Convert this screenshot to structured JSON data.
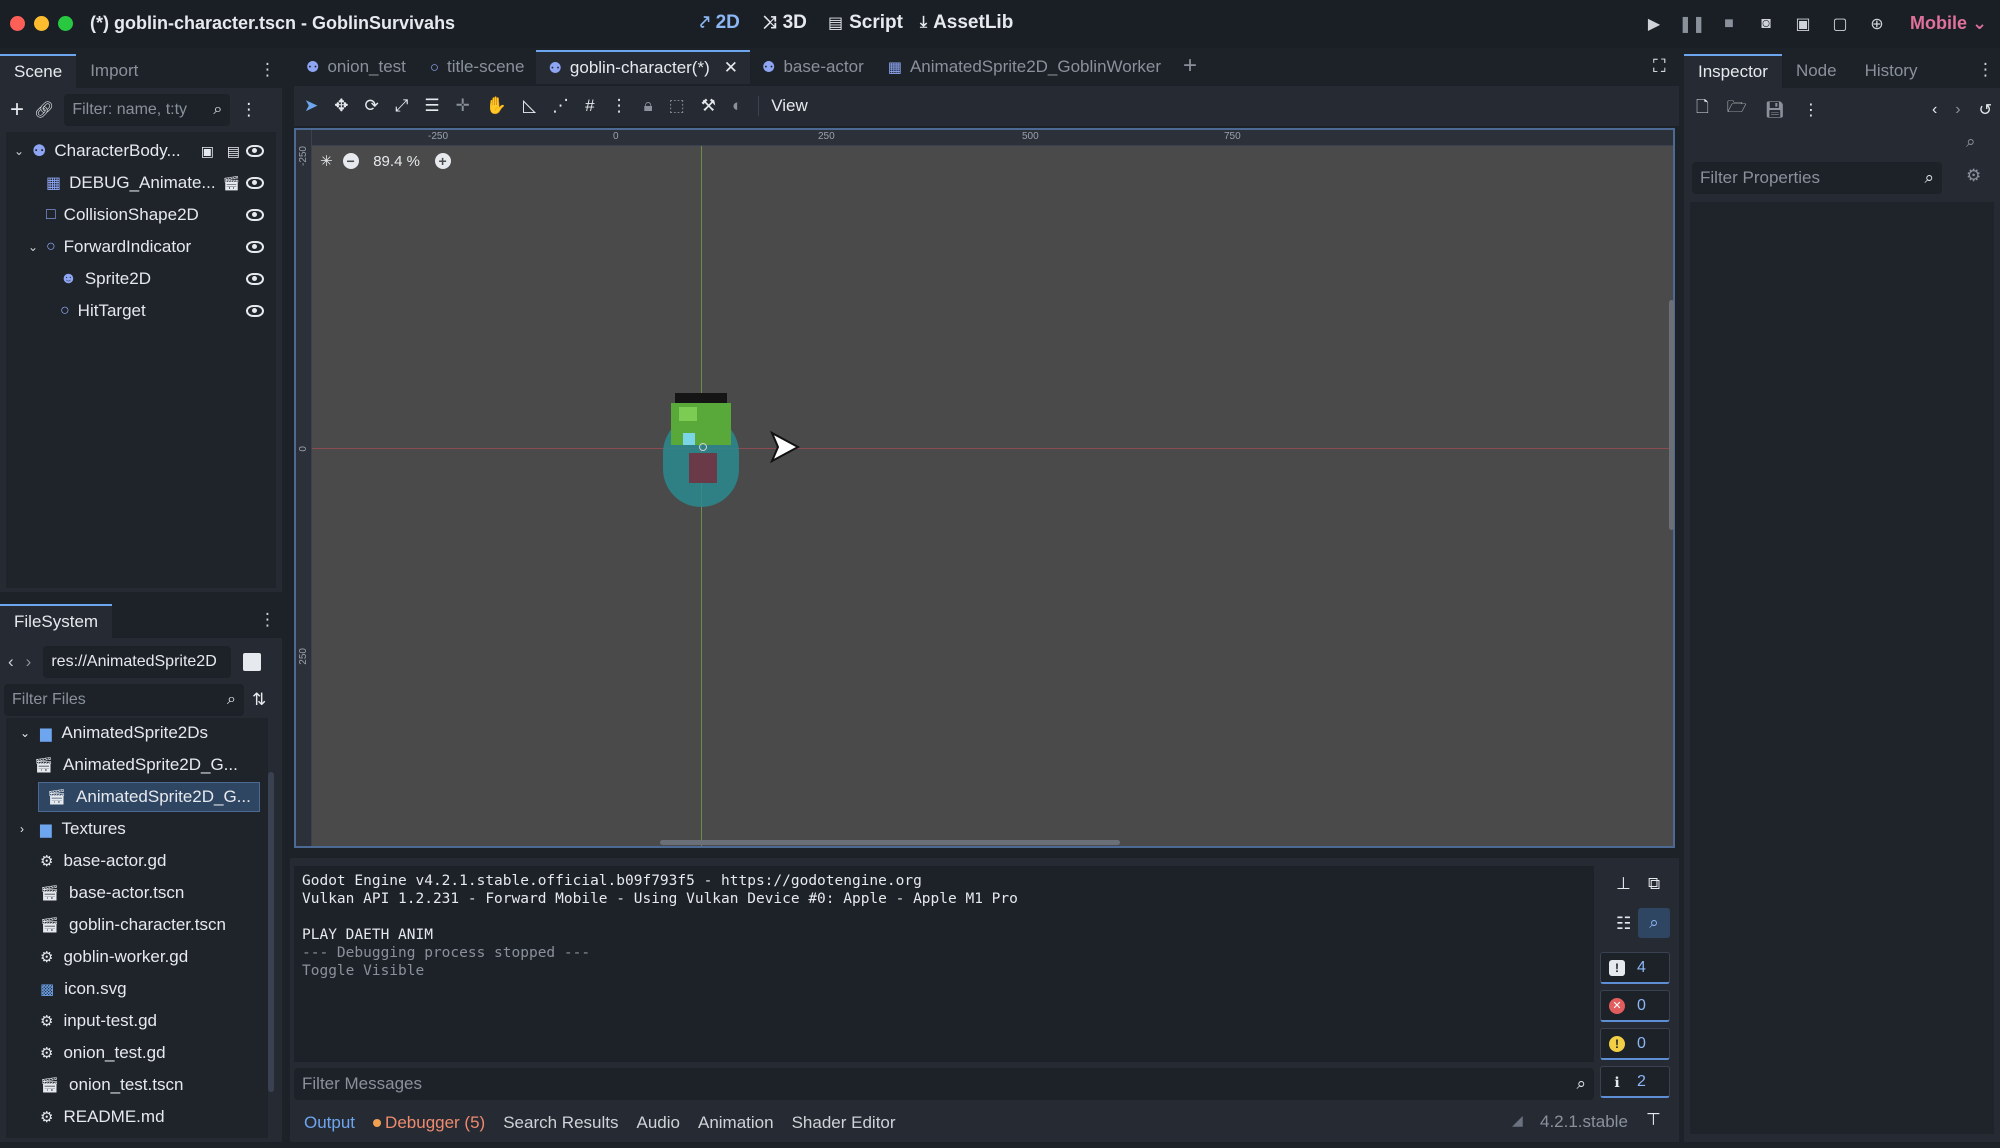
{
  "window": {
    "title": "(*) goblin-character.tscn - GoblinSurvivahs"
  },
  "modes": [
    {
      "label": "2D",
      "icon": "2d-icon",
      "active": true
    },
    {
      "label": "3D",
      "icon": "3d-icon"
    },
    {
      "label": "Script",
      "icon": "script-icon"
    },
    {
      "label": "AssetLib",
      "icon": "assetlib-icon"
    }
  ],
  "renderer": "Mobile ⌄",
  "scene_dock": {
    "tabs": [
      "Scene",
      "Import"
    ],
    "filter_placeholder": "Filter: name, t:ty",
    "nodes": [
      {
        "label": "CharacterBody...",
        "depth": 0,
        "expanded": true,
        "icon": "characterbody-icon",
        "color": "#8da5f3"
      },
      {
        "label": "DEBUG_Animate...",
        "depth": 1,
        "icon": "animatedsprite-icon",
        "color": "#8da5f3"
      },
      {
        "label": "CollisionShape2D",
        "depth": 1,
        "icon": "collisionshape-icon",
        "color": "#8da5f3"
      },
      {
        "label": "ForwardIndicator",
        "depth": 1,
        "expanded": true,
        "icon": "node2d-icon",
        "color": "#8da5f3"
      },
      {
        "label": "Sprite2D",
        "depth": 2,
        "icon": "sprite-icon",
        "color": "#8da5f3"
      },
      {
        "label": "HitTarget",
        "depth": 2,
        "icon": "node2d-icon",
        "color": "#8da5f3"
      }
    ]
  },
  "filesystem": {
    "tab": "FileSystem",
    "path": "res://AnimatedSprite2D",
    "filter_placeholder": "Filter Files",
    "items": [
      {
        "label": "AnimatedSprite2Ds",
        "type": "folder",
        "depth": 0,
        "expanded": true
      },
      {
        "label": "AnimatedSprite2D_G...",
        "type": "scene",
        "depth": 1
      },
      {
        "label": "AnimatedSprite2D_G...",
        "type": "scene",
        "depth": 1,
        "selected": true
      },
      {
        "label": "Textures",
        "type": "folder",
        "depth": 0
      },
      {
        "label": "base-actor.gd",
        "type": "script",
        "depth": 0
      },
      {
        "label": "base-actor.tscn",
        "type": "scene",
        "depth": 0
      },
      {
        "label": "goblin-character.tscn",
        "type": "scene",
        "depth": 0
      },
      {
        "label": "goblin-worker.gd",
        "type": "script",
        "depth": 0
      },
      {
        "label": "icon.svg",
        "type": "image",
        "depth": 0
      },
      {
        "label": "input-test.gd",
        "type": "script",
        "depth": 0
      },
      {
        "label": "onion_test.gd",
        "type": "script",
        "depth": 0
      },
      {
        "label": "onion_test.tscn",
        "type": "scene",
        "depth": 0
      },
      {
        "label": "README.md",
        "type": "script",
        "depth": 0
      }
    ]
  },
  "scene_tabs": [
    {
      "label": "onion_test",
      "icon": "characterbody-icon"
    },
    {
      "label": "title-scene",
      "icon": "node2d-icon"
    },
    {
      "label": "goblin-character(*)",
      "icon": "characterbody-icon",
      "active": true
    },
    {
      "label": "base-actor",
      "icon": "characterbody-icon"
    },
    {
      "label": "AnimatedSprite2D_GoblinWorker",
      "icon": "animatedsprite-icon"
    }
  ],
  "toolbar": {
    "view_label": "View"
  },
  "viewport": {
    "zoom": "89.4 %",
    "ruler_top": [
      "-250",
      "0",
      "250",
      "500",
      "750"
    ],
    "ruler_left": [
      "-250",
      "0",
      "250"
    ]
  },
  "output": {
    "lines": [
      "Godot Engine v4.2.1.stable.official.b09f793f5 - https://godotengine.org",
      "Vulkan API 1.2.231 - Forward Mobile - Using Vulkan Device #0: Apple - Apple M1 Pro",
      "",
      "PLAY DAETH ANIM",
      "--- Debugging process stopped ---",
      "Toggle Visible"
    ],
    "filter_placeholder": "Filter Messages",
    "counts": {
      "messages": "4",
      "errors": "0",
      "warnings": "0",
      "info": "2"
    }
  },
  "bottom_tabs": [
    "Output",
    "Debugger (5)",
    "Search Results",
    "Audio",
    "Animation",
    "Shader Editor"
  ],
  "version": "4.2.1.stable",
  "inspector": {
    "tabs": [
      "Inspector",
      "Node",
      "History"
    ],
    "filter_placeholder": "Filter Properties"
  },
  "colors": {
    "accent": "#6ea5ef",
    "debugger": "#f08a6e",
    "renderer": "#e0719b",
    "selected_row": "#2f4663"
  }
}
